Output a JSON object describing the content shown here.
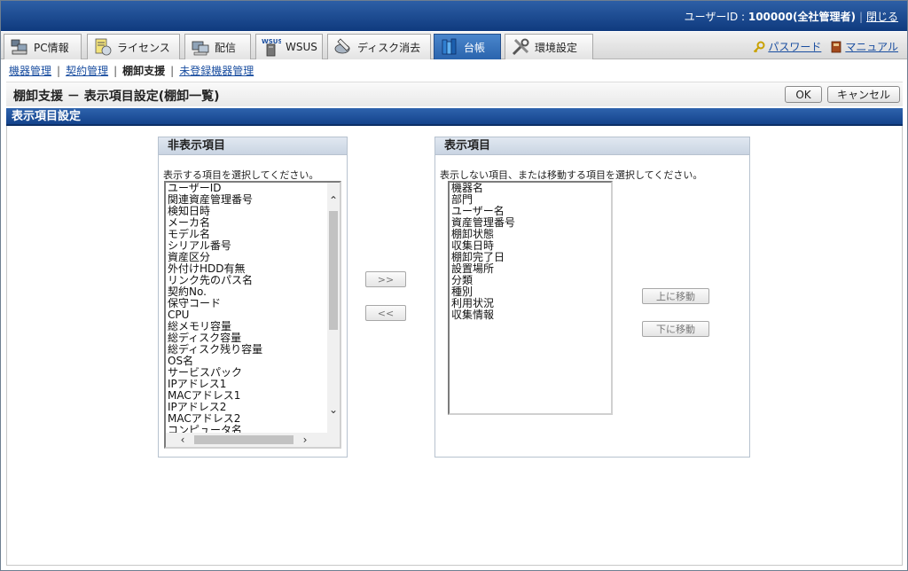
{
  "header": {
    "user_label": "ユーザーID : ",
    "user_value": "100000(全社管理者)",
    "logout_label": "閉じる"
  },
  "menu": {
    "tabs": [
      {
        "label": "PC情報",
        "icon": "pc-icon"
      },
      {
        "label": "ライセンス",
        "icon": "license-icon"
      },
      {
        "label": "配信",
        "icon": "distribution-icon"
      },
      {
        "label": "WSUS",
        "icon": "wsus-icon"
      },
      {
        "label": "ディスク消去",
        "icon": "disk-erase-icon"
      },
      {
        "label": "台帳",
        "icon": "ledger-icon"
      },
      {
        "label": "環境設定",
        "icon": "settings-icon"
      }
    ],
    "password_label": "パスワード",
    "manual_label": "マニュアル"
  },
  "subnav": {
    "items": [
      "機器管理",
      "契約管理",
      "棚卸支援",
      "未登録機器管理"
    ]
  },
  "page": {
    "title": "棚卸支援 － 表示項目設定(棚卸一覧)",
    "ok_label": "OK",
    "cancel_label": "キャンセル",
    "section_title": "表示項目設定"
  },
  "hidden_panel": {
    "title": "非表示項目",
    "hint": "表示する項目を選択してください。",
    "items": [
      "ユーザーID",
      "関連資産管理番号",
      "検知日時",
      "メーカ名",
      "モデル名",
      "シリアル番号",
      "資産区分",
      "外付けHDD有無",
      "リンク先のパス名",
      "契約No.",
      "保守コード",
      "CPU",
      "総メモリ容量",
      "総ディスク容量",
      "総ディスク残り容量",
      "OS名",
      "サービスパック",
      "IPアドレス1",
      "MACアドレス1",
      "IPアドレス2",
      "MACアドレス2",
      "コンピュータ名"
    ]
  },
  "transfer": {
    "add_label": ">>",
    "remove_label": "<<"
  },
  "shown_panel": {
    "title": "表示項目",
    "hint": "表示しない項目、または移動する項目を選択してください。",
    "items": [
      "機器名",
      "部門",
      "ユーザー名",
      "資産管理番号",
      "棚卸状態",
      "収集日時",
      "棚卸完了日",
      "設置場所",
      "分類",
      "種別",
      "利用状況",
      "収集情報"
    ],
    "move_up_label": "上に移動",
    "move_down_label": "下に移動"
  }
}
